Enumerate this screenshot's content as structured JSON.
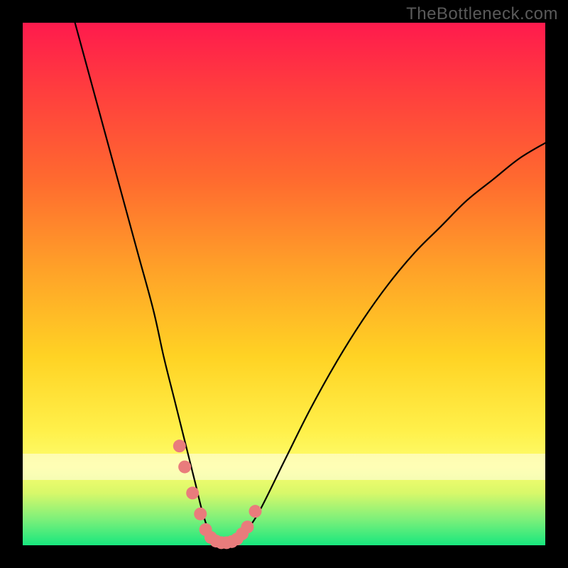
{
  "watermark": "TheBottleneck.com",
  "chart_data": {
    "type": "line",
    "title": "",
    "xlabel": "",
    "ylabel": "",
    "xlim": [
      0,
      100
    ],
    "ylim": [
      0,
      100
    ],
    "series": [
      {
        "name": "bottleneck-curve",
        "x": [
          10,
          13,
          16,
          19,
          22,
          25,
          27,
          29,
          31,
          33,
          34.5,
          36,
          38,
          40,
          42,
          45,
          50,
          55,
          60,
          65,
          70,
          75,
          80,
          85,
          90,
          95,
          100
        ],
        "values": [
          100,
          89,
          78,
          67,
          56,
          45,
          36,
          28,
          20,
          12,
          6,
          2,
          0,
          0,
          2,
          6,
          16,
          26,
          35,
          43,
          50,
          56,
          61,
          66,
          70,
          74,
          77
        ]
      }
    ],
    "markers": {
      "name": "highlight-dots",
      "color": "#e97c7c",
      "x": [
        30,
        31,
        32.5,
        34,
        35,
        36,
        37,
        38,
        39,
        40,
        41,
        42,
        43,
        44.5
      ],
      "values": [
        19,
        15,
        10,
        6,
        3,
        1.5,
        0.8,
        0.5,
        0.5,
        0.7,
        1.2,
        2.2,
        3.5,
        6.5
      ]
    },
    "gradient_stops": [
      {
        "pos": 0.0,
        "color": "#ff1a4d"
      },
      {
        "pos": 0.12,
        "color": "#ff3b3f"
      },
      {
        "pos": 0.3,
        "color": "#ff6a2f"
      },
      {
        "pos": 0.48,
        "color": "#ffa428"
      },
      {
        "pos": 0.64,
        "color": "#ffd324"
      },
      {
        "pos": 0.78,
        "color": "#fff04a"
      },
      {
        "pos": 0.85,
        "color": "#fdfd6e"
      },
      {
        "pos": 0.9,
        "color": "#d8f86a"
      },
      {
        "pos": 0.95,
        "color": "#7df07a"
      },
      {
        "pos": 1.0,
        "color": "#18e77e"
      }
    ]
  }
}
